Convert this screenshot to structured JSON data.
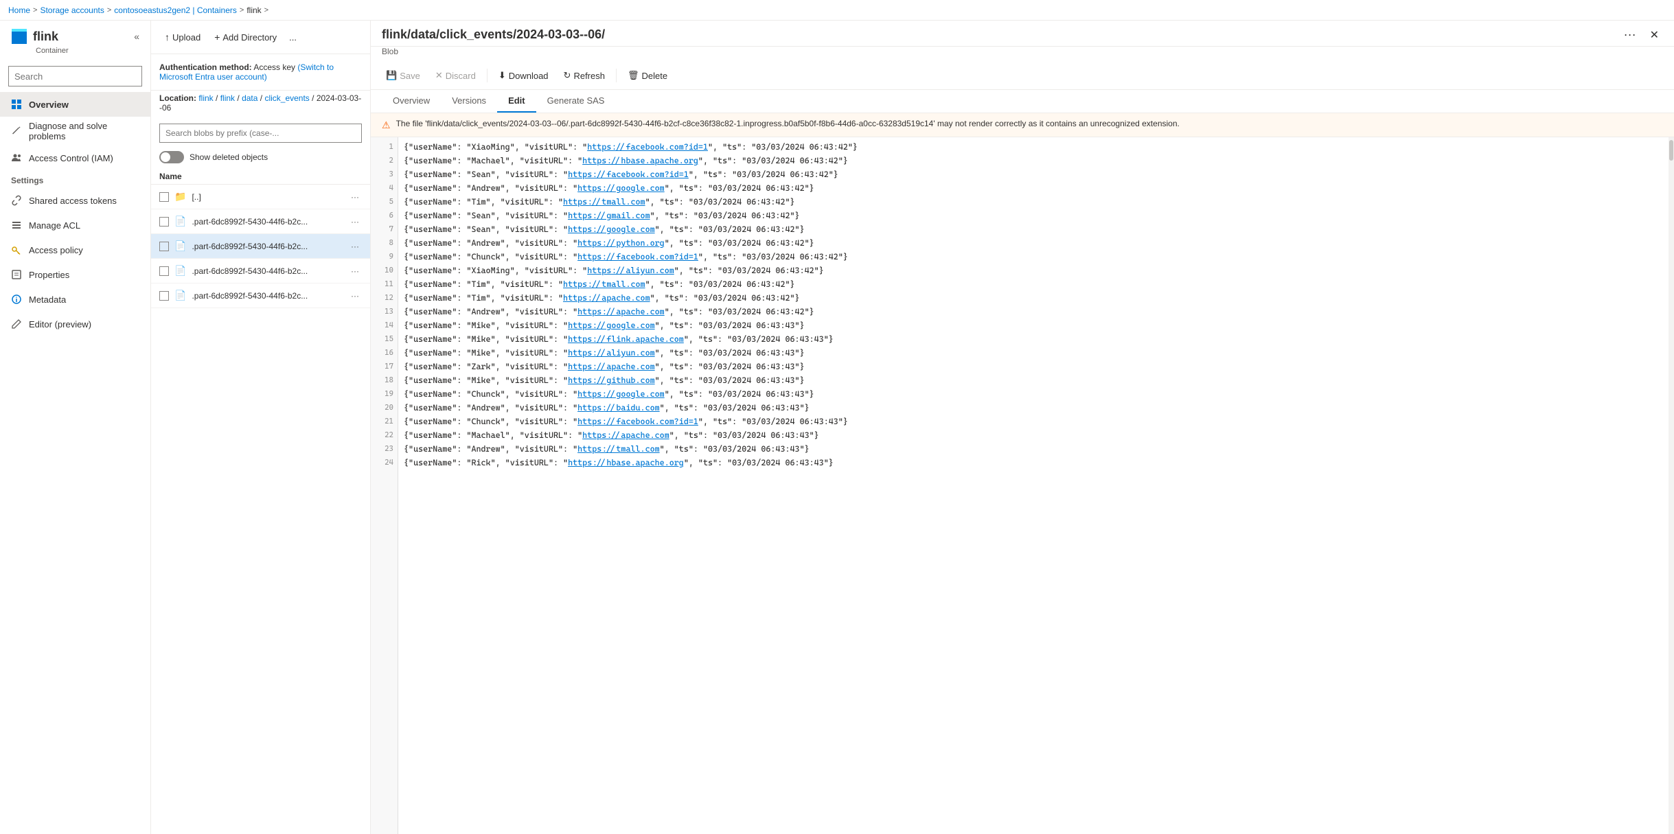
{
  "breadcrumb": {
    "items": [
      "Home",
      "Storage accounts",
      "contosoeastus2gen2 | Containers",
      "flink"
    ],
    "separators": [
      ">",
      ">",
      ">",
      ">"
    ]
  },
  "sidebar": {
    "title": "flink",
    "subtitle": "Container",
    "search_placeholder": "Search",
    "nav_items": [
      {
        "id": "overview",
        "label": "Overview",
        "icon": "grid",
        "active": true
      },
      {
        "id": "diagnose",
        "label": "Diagnose and solve problems",
        "icon": "wrench",
        "active": false
      },
      {
        "id": "access-control",
        "label": "Access Control (IAM)",
        "icon": "people",
        "active": false
      }
    ],
    "settings_label": "Settings",
    "settings_items": [
      {
        "id": "shared-access-tokens",
        "label": "Shared access tokens",
        "icon": "link",
        "active": false
      },
      {
        "id": "manage-acl",
        "label": "Manage ACL",
        "icon": "list",
        "active": false
      },
      {
        "id": "access-policy",
        "label": "Access policy",
        "icon": "key",
        "active": false
      },
      {
        "id": "properties",
        "label": "Properties",
        "icon": "info",
        "active": false
      },
      {
        "id": "metadata",
        "label": "Metadata",
        "icon": "info-circle",
        "active": false
      },
      {
        "id": "editor",
        "label": "Editor (preview)",
        "icon": "edit",
        "active": false
      }
    ]
  },
  "middle_panel": {
    "toolbar": {
      "upload_label": "Upload",
      "add_directory_label": "Add Directory",
      "more_label": "..."
    },
    "auth": {
      "method_label": "Authentication method:",
      "method_value": "Access key",
      "switch_text": "(Switch to Microsoft Entra user account)"
    },
    "location": {
      "label": "Location:",
      "path": [
        "flink",
        "flink",
        "data",
        "click_events"
      ],
      "current": "2024-03-03--06"
    },
    "search_placeholder": "Search blobs by prefix (case-...",
    "show_deleted_label": "Show deleted objects",
    "column_name": "Name",
    "files": [
      {
        "id": "parent",
        "name": "[..]",
        "type": "folder",
        "selected": false
      },
      {
        "id": "file1",
        "name": ".part-6dc8992f-5430-44f6-b2c...",
        "type": "file",
        "selected": false
      },
      {
        "id": "file2",
        "name": ".part-6dc8992f-5430-44f6-b2c...",
        "type": "file",
        "selected": true
      },
      {
        "id": "file3",
        "name": ".part-6dc8992f-5430-44f6-b2c...",
        "type": "file",
        "selected": false
      },
      {
        "id": "file4",
        "name": ".part-6dc8992f-5430-44f6-b2c...",
        "type": "file",
        "selected": false
      }
    ]
  },
  "right_panel": {
    "title": "flink/data/click_events/2024-03-03--06/",
    "subtitle": "Blob",
    "toolbar": {
      "save_label": "Save",
      "discard_label": "Discard",
      "download_label": "Download",
      "refresh_label": "Refresh",
      "delete_label": "Delete"
    },
    "tabs": [
      "Overview",
      "Versions",
      "Edit",
      "Generate SAS"
    ],
    "active_tab": "Edit",
    "warning": "The file 'flink/data/click_events/2024-03-03--06/.part-6dc8992f-5430-44f6-b2cf-c8ce36f38c82-1.inprogress.b0af5b0f-f8b6-44d6-a0cc-63283d519c14' may not render correctly as it contains an unrecognized extension.",
    "code_lines": [
      {
        "num": 1,
        "content": "{\"userName\": \"XiaoMing\", \"visitURL\": \"https://facebook.com?id=1\", \"ts\": \"03/03/2024 06:43:42\"}",
        "highlight": false
      },
      {
        "num": 2,
        "content": "{\"userName\": \"Machael\", \"visitURL\": \"https://hbase.apache.org\", \"ts\": \"03/03/2024 06:43:42\"}",
        "highlight": false
      },
      {
        "num": 3,
        "content": "{\"userName\": \"Sean\", \"visitURL\": \"https://facebook.com?id=1\", \"ts\": \"03/03/2024 06:43:42\"}",
        "highlight": false
      },
      {
        "num": 4,
        "content": "{\"userName\": \"Andrew\", \"visitURL\": \"https://google.com\", \"ts\": \"03/03/2024 06:43:42\"}",
        "highlight": false
      },
      {
        "num": 5,
        "content": "{\"userName\": \"Tim\", \"visitURL\": \"https://tmall.com\", \"ts\": \"03/03/2024 06:43:42\"}",
        "highlight": false
      },
      {
        "num": 6,
        "content": "{\"userName\": \"Sean\", \"visitURL\": \"https://gmail.com\", \"ts\": \"03/03/2024 06:43:42\"}",
        "highlight": false
      },
      {
        "num": 7,
        "content": "{\"userName\": \"Sean\", \"visitURL\": \"https://google.com\", \"ts\": \"03/03/2024 06:43:42\"}",
        "highlight": false
      },
      {
        "num": 8,
        "content": "{\"userName\": \"Andrew\", \"visitURL\": \"https://python.org\", \"ts\": \"03/03/2024 06:43:42\"}",
        "highlight": false
      },
      {
        "num": 9,
        "content": "{\"userName\": \"Chunck\", \"visitURL\": \"https://facebook.com?id=1\", \"ts\": \"03/03/2024 06:43:42\"}",
        "highlight": false
      },
      {
        "num": 10,
        "content": "{\"userName\": \"XiaoMing\", \"visitURL\": \"https://aliyun.com\", \"ts\": \"03/03/2024 06:43:42\"}",
        "highlight": false
      },
      {
        "num": 11,
        "content": "{\"userName\": \"Tim\", \"visitURL\": \"https://tmall.com\", \"ts\": \"03/03/2024 06:43:42\"}",
        "highlight": false
      },
      {
        "num": 12,
        "content": "{\"userName\": \"Tim\", \"visitURL\": \"https://apache.com\", \"ts\": \"03/03/2024 06:43:42\"}",
        "highlight": false
      },
      {
        "num": 13,
        "content": "{\"userName\": \"Andrew\", \"visitURL\": \"https://apache.com\", \"ts\": \"03/03/2024 06:43:42\"}",
        "highlight": false
      },
      {
        "num": 14,
        "content": "{\"userName\": \"Mike\", \"visitURL\": \"https://google.com\", \"ts\": \"03/03/2024 06:43:43\"}",
        "highlight": false
      },
      {
        "num": 15,
        "content": "{\"userName\": \"Mike\", \"visitURL\": \"https://flink.apache.com\", \"ts\": \"03/03/2024 06:43:43\"}",
        "highlight": false
      },
      {
        "num": 16,
        "content": "{\"userName\": \"Mike\", \"visitURL\": \"https://aliyun.com\", \"ts\": \"03/03/2024 06:43:43\"}",
        "highlight": false
      },
      {
        "num": 17,
        "content": "{\"userName\": \"Zark\", \"visitURL\": \"https://apache.com\", \"ts\": \"03/03/2024 06:43:43\"}",
        "highlight": false
      },
      {
        "num": 18,
        "content": "{\"userName\": \"Mike\", \"visitURL\": \"https://github.com\", \"ts\": \"03/03/2024 06:43:43\"}",
        "highlight": false
      },
      {
        "num": 19,
        "content": "{\"userName\": \"Chunck\", \"visitURL\": \"https://google.com\", \"ts\": \"03/03/2024 06:43:43\"}",
        "highlight": false
      },
      {
        "num": 20,
        "content": "{\"userName\": \"Andrew\", \"visitURL\": \"https://baidu.com\", \"ts\": \"03/03/2024 06:43:43\"}",
        "highlight": false
      },
      {
        "num": 21,
        "content": "{\"userName\": \"Chunck\", \"visitURL\": \"https://facebook.com?id=1\", \"ts\": \"03/03/2024 06:43:43\"}",
        "highlight": false
      },
      {
        "num": 22,
        "content": "{\"userName\": \"Machael\", \"visitURL\": \"https://apache.com\", \"ts\": \"03/03/2024 06:43:43\"}",
        "highlight": false
      },
      {
        "num": 23,
        "content": "{\"userName\": \"Andrew\", \"visitURL\": \"https://tmall.com\", \"ts\": \"03/03/2024 06:43:43\"}",
        "highlight": false
      },
      {
        "num": 24,
        "content": "{\"userName\": \"Rick\", \"visitURL\": \"https://hbase.apache.org\", \"ts\": \"03/03/2024 06:43:43\"}",
        "highlight": false
      }
    ]
  }
}
